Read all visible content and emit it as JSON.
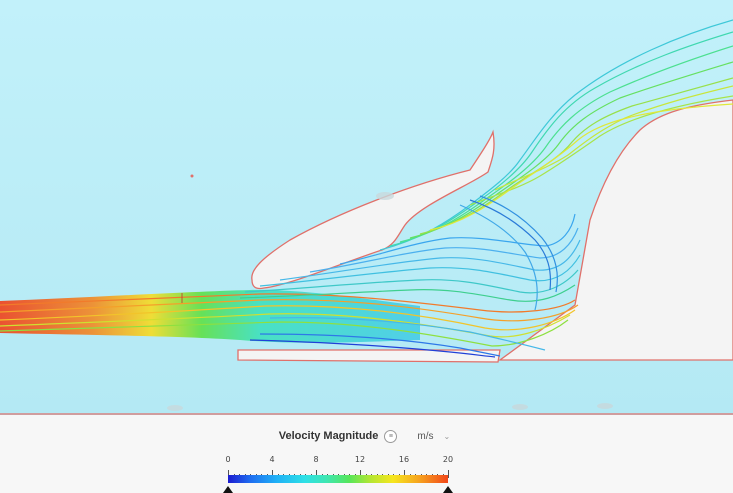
{
  "legend": {
    "title": "Velocity Magnitude",
    "info_icon": "info-icon",
    "unit": "m/s",
    "unit_caret_icon": "chevron-down-icon",
    "min": 0,
    "max": 20,
    "ticks": [
      "0",
      "4",
      "8",
      "12",
      "16",
      "20"
    ],
    "colorscale": [
      "#1c1cd0",
      "#1fb0f6",
      "#2ee0e6",
      "#56e65a",
      "#f6e61f",
      "#f2471a"
    ]
  },
  "viewport": {
    "background_color": "#bdeff8",
    "geometry_fill": "#f4f4f4",
    "outline_color": "#e0706a"
  }
}
